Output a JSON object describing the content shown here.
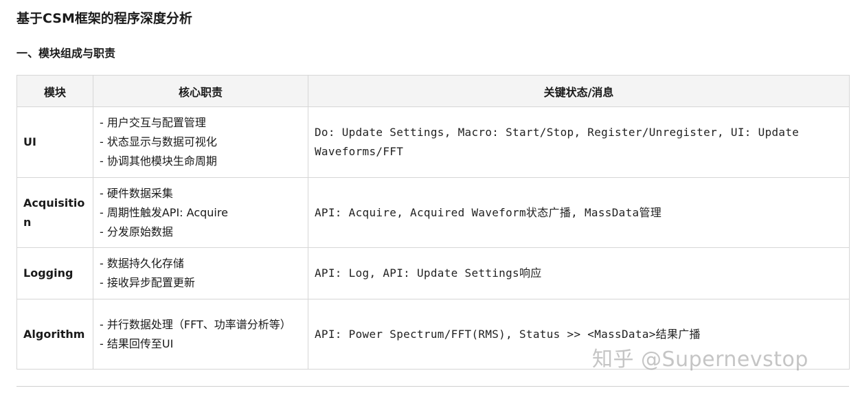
{
  "title": "基于CSM框架的程序深度分析",
  "section": "一、模块组成与职责",
  "table": {
    "headers": [
      "模块",
      "核心职责",
      "关键状态/消息"
    ],
    "rows": [
      {
        "module": "UI",
        "responsibilities": [
          "- 用户交互与配置管理",
          "- 状态显示与数据可视化",
          "- 协调其他模块生命周期"
        ],
        "key": "Do: Update Settings, Macro: Start/Stop, Register/Unregister, UI: Update Waveforms/FFT"
      },
      {
        "module": "Acquisition",
        "responsibilities": [
          "- 硬件数据采集",
          "- 周期性触发API: Acquire",
          "- 分发原始数据"
        ],
        "key": "API: Acquire, Acquired Waveform状态广播, MassData管理"
      },
      {
        "module": "Logging",
        "responsibilities": [
          "- 数据持久化存储",
          "- 接收异步配置更新"
        ],
        "key": "API: Log, API: Update Settings响应"
      },
      {
        "module": "Algorithm",
        "responsibilities": [
          "- 并行数据处理（FFT、功率谱分析等）",
          "- 结果回传至UI"
        ],
        "key": "API: Power Spectrum/FFT(RMS), Status >> <MassData>结果广播"
      }
    ]
  },
  "watermark": "知乎 @Supernevstop"
}
